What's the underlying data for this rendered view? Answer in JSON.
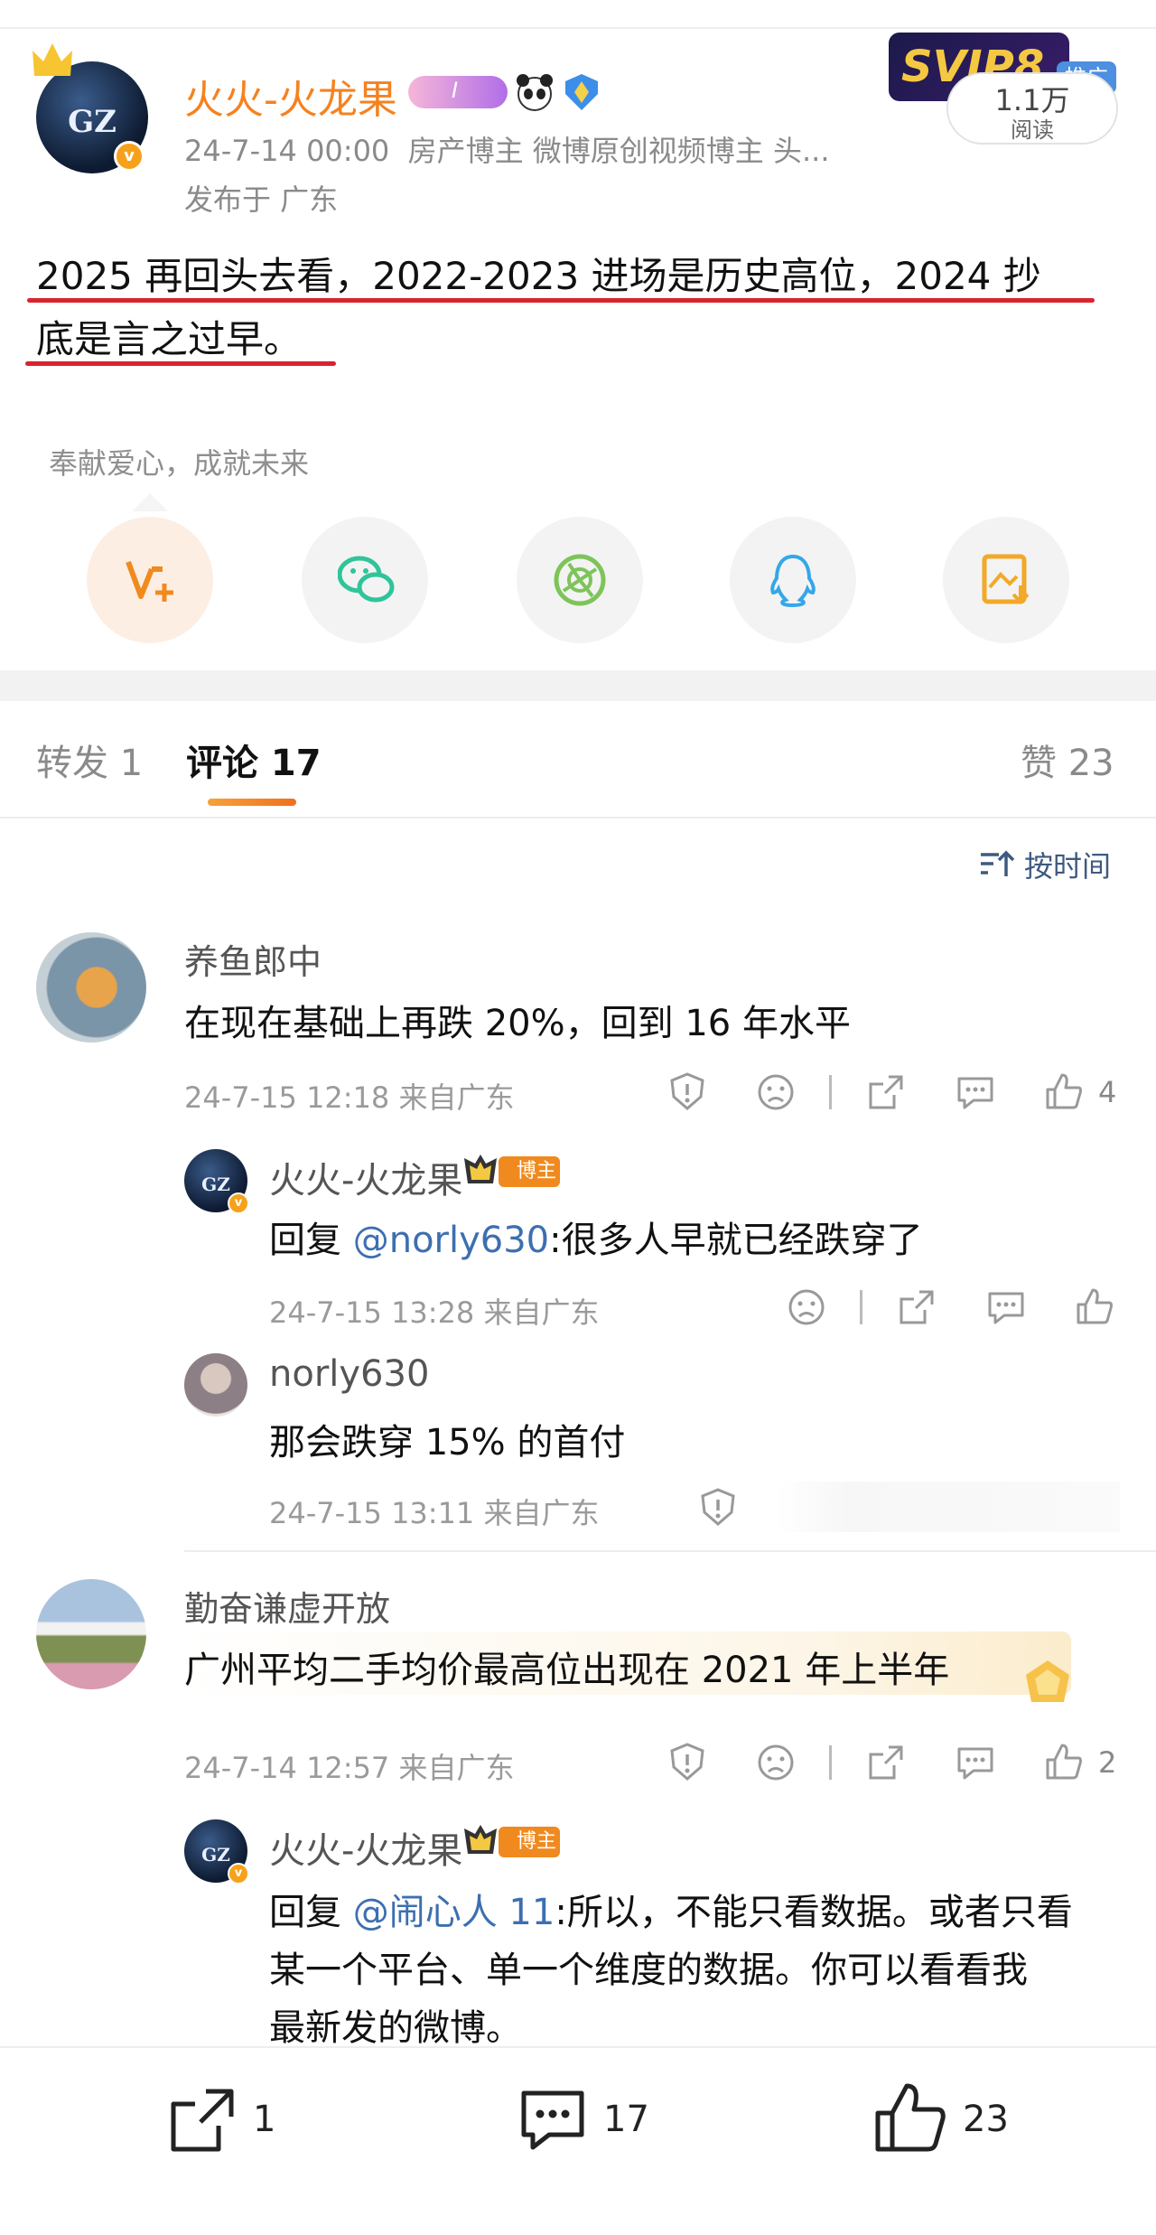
{
  "post": {
    "author": "火火-火龙果",
    "time": "24-7-14 00:00",
    "tags": "房产博主 微博原创视频博主 头...",
    "location": "发布于 广东",
    "content_line1": "2025 再回头去看，2022-2023 进场是历史高位，2024 抄",
    "content_line2": "底是言之过早。",
    "level_badge": "I",
    "ad_label": "推广",
    "ad_brand": "SVIP8",
    "read_count": "1.1万",
    "read_label": "阅读",
    "donation_text": "奉献爱心，成就未来"
  },
  "share_icons": [
    "weibo-plus-icon",
    "wechat-icon",
    "moments-icon",
    "qq-icon",
    "save-image-icon"
  ],
  "tabs": {
    "repost": "转发 1",
    "comments": "评论 17",
    "likes": "赞 23"
  },
  "sort_label": "按时间",
  "comments": [
    {
      "name": "养鱼郎中",
      "text": "在现在基础上再跌 20%，回到 16 年水平",
      "meta": "24-7-15 12:18  来自广东",
      "likes": "4",
      "replies": [
        {
          "name": "火火-火龙果",
          "badge": "博主",
          "prefix": "回复 ",
          "mention": "@norly630",
          "text": ":很多人早就已经跌穿了",
          "meta": "24-7-15 13:28  来自广东"
        },
        {
          "name": "norly630",
          "text": "那会跌穿 15% 的首付",
          "meta": "24-7-15 13:11  来自广东"
        }
      ]
    },
    {
      "name": "勤奋谦虚开放",
      "text": "广州平均二手均价最高位出现在 2021 年上半年",
      "meta": "24-7-14 12:57  来自广东",
      "likes": "2",
      "replies": [
        {
          "name": "火火-火龙果",
          "badge": "博主",
          "prefix": "回复 ",
          "mention": "@闹心人 11",
          "text_line1": ":所以，不能只看数据。或者只看",
          "text_line2": "某一个平台、单一个维度的数据。你可以看看我",
          "text_line3": "最新发的微博。"
        }
      ]
    }
  ],
  "bottom_bar": {
    "repost_count": "1",
    "comment_count": "17",
    "like_count": "23"
  },
  "colors": {
    "accent_orange": "#f58220",
    "underline_red": "#d9232e",
    "link_blue": "#3d6fb0"
  }
}
